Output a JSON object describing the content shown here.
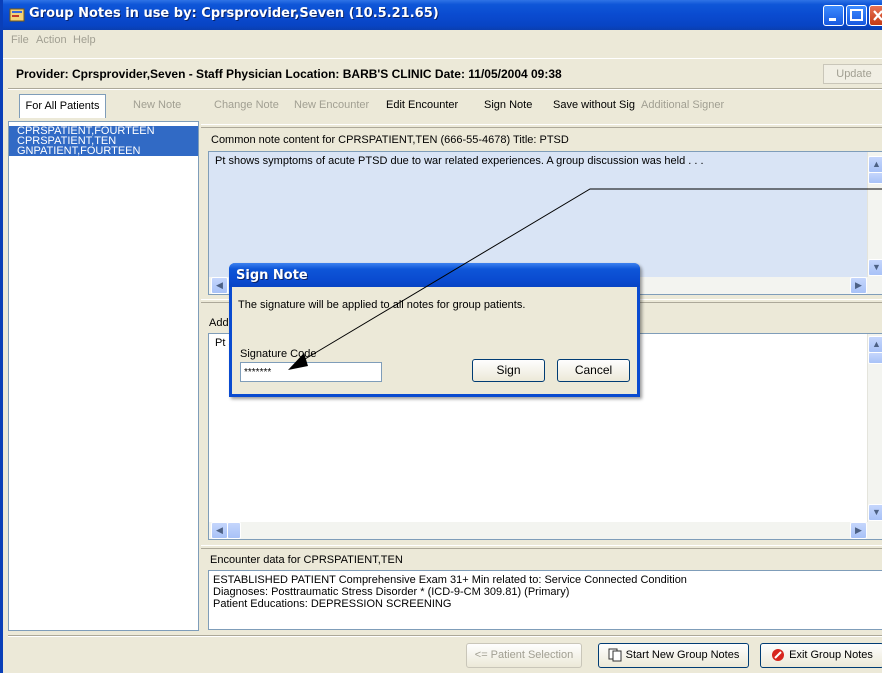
{
  "window": {
    "title": "Group Notes in use by: Cprsprovider,Seven  (10.5.21.65)"
  },
  "menu": {
    "items": [
      "File",
      "Action",
      "Help"
    ]
  },
  "provider_bar": {
    "info": "Provider: Cprsprovider,Seven - Staff Physician  Location: BARB'S CLINIC  Date: 11/05/2004 09:38",
    "update_label": "Update"
  },
  "toolbar": {
    "all_patients": "For All Patients",
    "new_note": "New Note",
    "change_note": "Change Note",
    "new_encounter": "New Encounter",
    "edit_encounter": "Edit Encounter",
    "sign_note": "Sign Note",
    "save_without_sig": "Save without Sig",
    "additional_signer": "Additional Signer"
  },
  "patients": [
    "CPRSPATIENT,FOURTEEN",
    "CPRSPATIENT,TEN",
    "GNPATIENT,FOURTEEN"
  ],
  "common_note": {
    "label": "Common note content for CPRSPATIENT,TEN (666-55-4678)  Title: PTSD",
    "text": "Pt shows symptoms of acute PTSD due to war related experiences. A group discussion was held . . ."
  },
  "additional": {
    "label": "Addi",
    "text": "Pt s"
  },
  "encounter": {
    "label": "Encounter data for CPRSPATIENT,TEN",
    "lines": [
      "ESTABLISHED PATIENT Comprehensive Exam   31+ Min related to:  Service Connected Condition",
      "Diagnoses: Posttraumatic Stress Disorder * (ICD-9-CM 309.81) (Primary)",
      "Patient Educations: DEPRESSION SCREENING"
    ]
  },
  "bottom_buttons": {
    "patient_selection": "<= Patient Selection",
    "start_new": "Start New Group Notes",
    "exit": "Exit Group Notes"
  },
  "dialog": {
    "title": "Sign Note",
    "message": "The signature will be applied to all notes for group patients.",
    "signature_label": "Signature Code",
    "signature_value": "*******",
    "sign_label": "Sign",
    "cancel_label": "Cancel"
  },
  "colors": {
    "titlebar": "#0a4bd0",
    "selection": "#316ac5",
    "note_background": "#d9e4f5",
    "window_face": "#ece9d8"
  }
}
